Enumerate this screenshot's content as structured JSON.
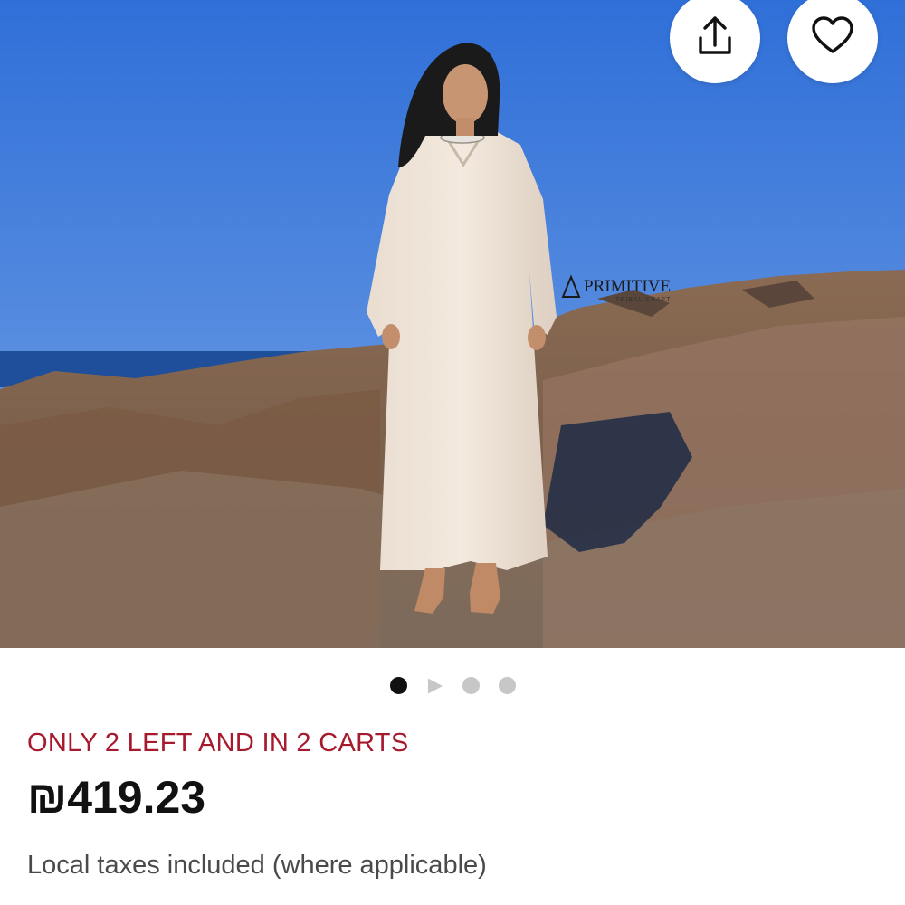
{
  "listing": {
    "watermark_brand": "PRIMITIVE",
    "watermark_sub": "TRIBAL CRAFT",
    "scarcity_text": "ONLY 2 LEFT AND IN 2 CARTS",
    "price": "₪419.23",
    "tax_note": "Local taxes included (where applicable)"
  },
  "carousel": {
    "total_items": 4,
    "active_index": 0,
    "video_index": 1
  },
  "icons": {
    "share": "share-icon",
    "favorite": "heart-icon",
    "video": "play-icon"
  },
  "colors": {
    "scarcity": "#a61a2e",
    "price": "#111111",
    "active_dot": "#111111",
    "inactive_dot": "#c7c7c7"
  }
}
